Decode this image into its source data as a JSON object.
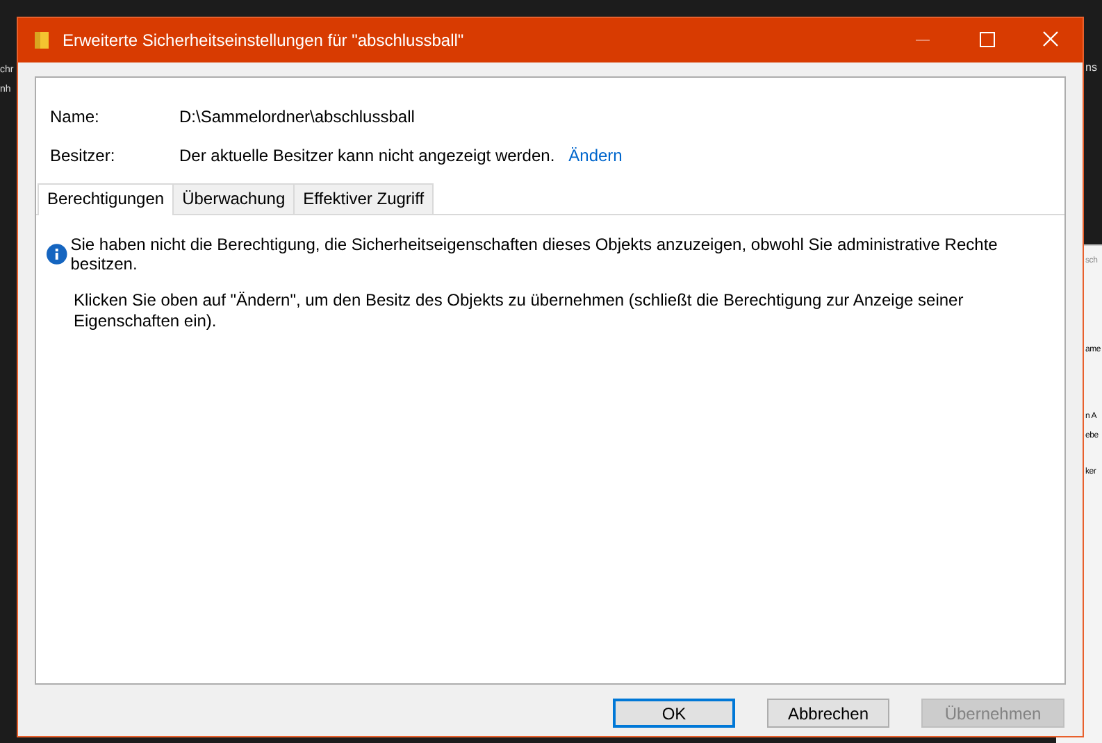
{
  "desktop": {
    "left_fragments": [
      "chr",
      "nh"
    ],
    "right_top_fragment": "ns",
    "back_window_fragments": [
      "sch",
      "ame",
      "n A",
      "ebe",
      "ker"
    ]
  },
  "window": {
    "title": "Erweiterte Sicherheitseinstellungen für \"abschlussball\""
  },
  "fields": [
    {
      "label": "Name:",
      "value": "D:\\Sammelordner\\abschlussball"
    },
    {
      "label": "Besitzer:",
      "value": "Der aktuelle Besitzer kann nicht angezeigt werden.",
      "link": "Ändern"
    }
  ],
  "tabs": [
    {
      "label": "Berechtigungen",
      "selected": true
    },
    {
      "label": "Überwachung",
      "selected": false
    },
    {
      "label": "Effektiver Zugriff",
      "selected": false
    }
  ],
  "message": {
    "info": "Sie haben nicht die Berechtigung, die Sicherheitseigenschaften dieses Objekts anzuzeigen, obwohl Sie administrative Rechte besitzen.",
    "hint": "Klicken Sie oben auf \"Ändern\", um den Besitz des Objekts zu übernehmen (schließt die Berechtigung zur Anzeige seiner Eigenschaften ein)."
  },
  "buttons": [
    {
      "label": "OK",
      "default": true,
      "disabled": false
    },
    {
      "label": "Abbrechen",
      "default": false,
      "disabled": false
    },
    {
      "label": "Übernehmen",
      "default": false,
      "disabled": true
    }
  ]
}
